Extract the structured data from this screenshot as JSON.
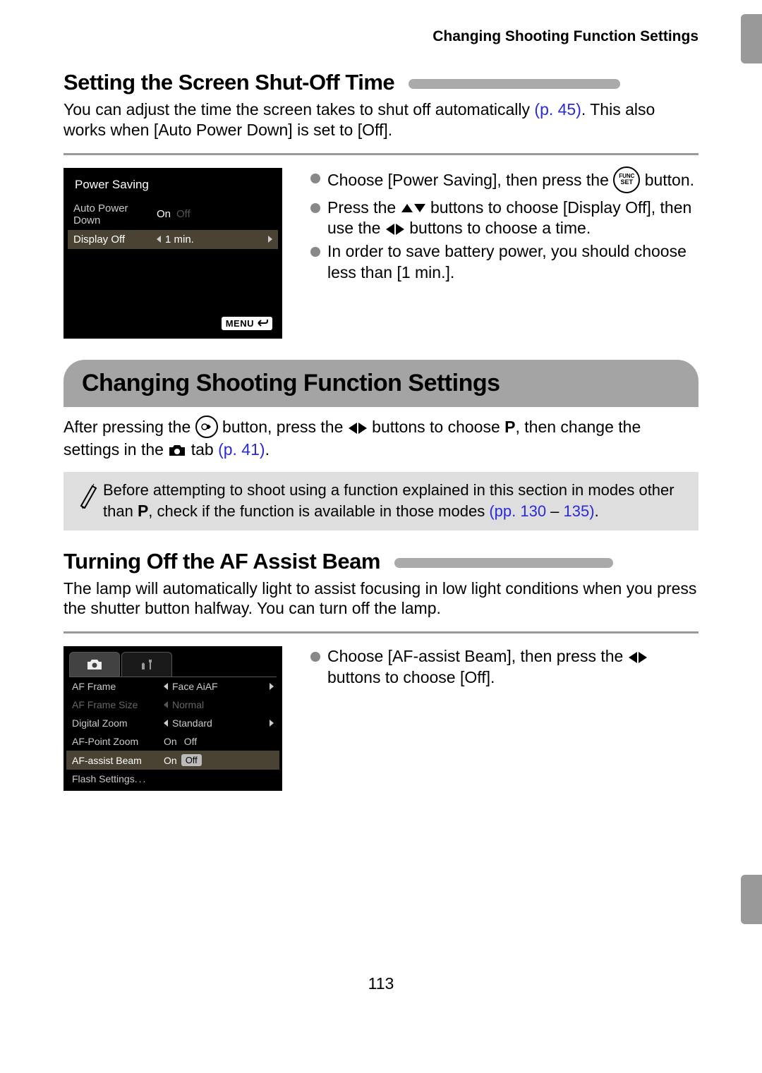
{
  "running_header": "Changing Shooting Function Settings",
  "section1": {
    "heading": "Setting the Screen Shut-Off Time",
    "para_a": "You can adjust the time the screen takes to shut off automatically ",
    "ref1": "(p. 45)",
    "para_b": ". This also works when [Auto Power Down] is set to [Off].",
    "bullet1_a": "Choose [Power Saving], then press the ",
    "bullet1_b": " button.",
    "bullet2_a": "Press the ",
    "bullet2_b": " buttons to choose [Display Off], then use the ",
    "bullet2_c": " buttons to choose a time.",
    "bullet3": "In order to save battery power, you should choose less than [1 min.]."
  },
  "lcd1": {
    "title": "Power Saving",
    "row1_label": "Auto Power Down",
    "row1_on": "On",
    "row1_off": "Off",
    "row2_label": "Display Off",
    "row2_value": "1 min.",
    "menu_label": "MENU"
  },
  "section_bar": "Changing Shooting Function Settings",
  "section2": {
    "para_a": "After pressing the ",
    "para_b": " button, press the ",
    "para_c": " buttons to choose ",
    "para_d": ", then change the settings in the ",
    "para_e": " tab ",
    "ref1": "(p. 41)",
    "para_f": "."
  },
  "note": {
    "text_a": "Before attempting to shoot using a function explained in this section in modes other than ",
    "text_b": ", check if the function is available in those modes ",
    "ref_a": "(pp. 130",
    "dash": " – ",
    "ref_b": "135)",
    "period": "."
  },
  "section3": {
    "heading": "Turning Off the AF Assist Beam",
    "para": "The lamp will automatically light to assist focusing in low light conditions when you press the shutter button halfway. You can turn off the lamp.",
    "bullet1_a": "Choose [AF-assist Beam], then press the ",
    "bullet1_b": " buttons to choose [Off]."
  },
  "lcd2": {
    "rows": {
      "r1_label": "AF Frame",
      "r1_val": "Face AiAF",
      "r2_label": "AF Frame Size",
      "r2_val": "Normal",
      "r3_label": "Digital Zoom",
      "r3_val": "Standard",
      "r4_label": "AF-Point Zoom",
      "r4_on": "On",
      "r4_off": "Off",
      "r5_label": "AF-assist Beam",
      "r5_on": "On",
      "r5_off": "Off",
      "r6_label": "Flash Settings"
    }
  },
  "page_number": "113",
  "func_top": "FUNC",
  "func_bot": "SET"
}
